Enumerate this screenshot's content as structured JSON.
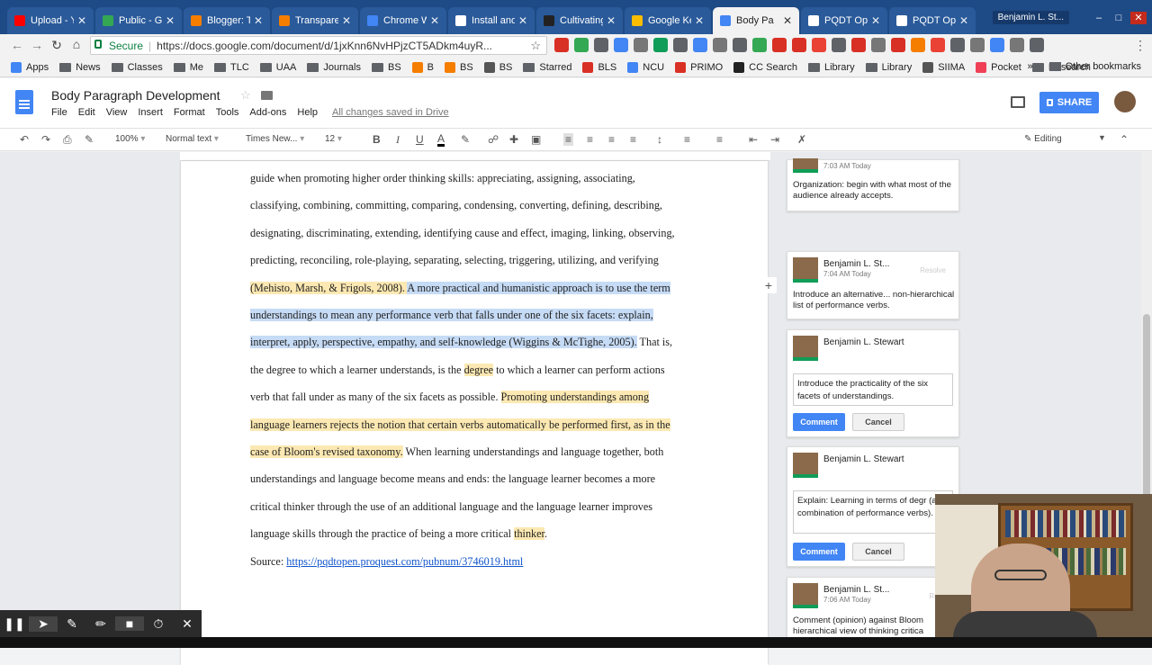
{
  "browser": {
    "tabs": [
      {
        "label": "Upload - Yo",
        "color": "#ff0000"
      },
      {
        "label": "Public - Go",
        "color": "#34a853"
      },
      {
        "label": "Blogger: Tr",
        "color": "#f57d00"
      },
      {
        "label": "Transparen",
        "color": "#f57d00"
      },
      {
        "label": "Chrome W",
        "color": "#4285f4"
      },
      {
        "label": "Install and",
        "color": "#ffffff"
      },
      {
        "label": "Cultivating",
        "color": "#222222"
      },
      {
        "label": "Google Ke",
        "color": "#fbbc04"
      },
      {
        "label": "Body Pa",
        "color": "#4285f4",
        "active": true
      },
      {
        "label": "PQDT Ope",
        "color": "#ffffff"
      },
      {
        "label": "PQDT Ope",
        "color": "#ffffff"
      }
    ],
    "window_user": "Benjamin L. St...",
    "address": {
      "secure_label": "Secure",
      "url": "https://docs.google.com/document/d/1jxKnn6NvHPjzCT5ADkm4uyR..."
    },
    "bookmarks": [
      {
        "label": "Apps",
        "type": "apps"
      },
      {
        "label": "News",
        "type": "folder"
      },
      {
        "label": "Classes",
        "type": "folder"
      },
      {
        "label": "Me",
        "type": "folder"
      },
      {
        "label": "TLC",
        "type": "folder"
      },
      {
        "label": "UAA",
        "type": "folder"
      },
      {
        "label": "Journals",
        "type": "folder"
      },
      {
        "label": "BS",
        "type": "folder"
      },
      {
        "label": "B",
        "type": "blogger"
      },
      {
        "label": "BS",
        "type": "blogger"
      },
      {
        "label": "BS",
        "type": "doc"
      },
      {
        "label": "Starred",
        "type": "folder"
      },
      {
        "label": "BLS",
        "type": "red"
      },
      {
        "label": "NCU",
        "type": "cloud"
      },
      {
        "label": "PRIMO",
        "type": "primo"
      },
      {
        "label": "CC Search",
        "type": "cc"
      },
      {
        "label": "Library",
        "type": "folder"
      },
      {
        "label": "Library",
        "type": "folder"
      },
      {
        "label": "SIIMA",
        "type": "doc"
      },
      {
        "label": "Pocket",
        "type": "pocket"
      },
      {
        "label": "Research",
        "type": "folder"
      }
    ],
    "other_bookmarks": "Other bookmarks"
  },
  "docs": {
    "title": "Body Paragraph Development",
    "menu": [
      "File",
      "Edit",
      "View",
      "Insert",
      "Format",
      "Tools",
      "Add-ons",
      "Help"
    ],
    "saved_status": "All changes saved in Drive",
    "share_label": "SHARE",
    "toolbar": {
      "zoom": "100%",
      "style": "Normal text",
      "font": "Times New...",
      "size": "12",
      "mode": "Editing"
    }
  },
  "document": {
    "lines": [
      [
        {
          "t": "guide when promoting higher order thinking skills: appreciating, assigning, associating,"
        }
      ],
      [
        {
          "t": "classifying, combining, committing, comparing, condensing, converting, defining, describing,"
        }
      ],
      [
        {
          "t": "designating, discriminating, extending, identifying cause and effect, imaging, linking, observing,"
        }
      ],
      [
        {
          "t": "predicting, reconciling, role-playing, separating, selecting, triggering, utilizing, and verifying"
        }
      ],
      [
        {
          "t": "(Mehisto, Marsh, & Frigols, 2008). ",
          "c": "hl"
        },
        {
          "t": "A more practical and humanistic approach is to use the term",
          "c": "sel"
        }
      ],
      [
        {
          "t": "understandings to mean any performance verb that falls under one of the six facets: explain,",
          "c": "sel"
        }
      ],
      [
        {
          "t": "interpret, apply, perspective, empathy, and self-knowledge (Wiggins & McTighe, 2005).",
          "c": "sel"
        },
        {
          "t": " That is,"
        }
      ],
      [
        {
          "t": "the degree to which a learner understands, is the "
        },
        {
          "t": "degree",
          "c": "hl"
        },
        {
          "t": " to which a learner can perform actions"
        }
      ],
      [
        {
          "t": "verb that fall under as many of the six facets as possible. "
        },
        {
          "t": "Promoting understandings among",
          "c": "hl"
        }
      ],
      [
        {
          "t": "language learners rejects the notion that certain verbs automatically be performed first, as in the",
          "c": "hl"
        }
      ],
      [
        {
          "t": "case of Bloom's revised taxonomy.",
          "c": "hl"
        },
        {
          "t": " When learning understandings and language together, both"
        }
      ],
      [
        {
          "t": "understandings and language become means and ends: the language learner becomes a more"
        }
      ],
      [
        {
          "t": "critical thinker through the use of an additional language and the language learner improves"
        }
      ],
      [
        {
          "t": "language skills through the practice of being a more critical "
        },
        {
          "t": "thinker",
          "c": "hl"
        },
        {
          "t": "."
        }
      ]
    ],
    "source_label": "Source: ",
    "source_link": "https://pqdtopen.proquest.com/pubnum/3746019.html"
  },
  "comments": [
    {
      "time": "7:03 AM Today",
      "body": "Organization: begin with what most of the audience already accepts."
    },
    {
      "name": "Benjamin L. St...",
      "time": "7:04 AM Today",
      "resolve": "Resolve",
      "body": "Introduce an alternative... non-hierarchical list of performance verbs."
    },
    {
      "name": "Benjamin L. Stewart",
      "input": "Introduce the practicality of the six facets of understandings.",
      "comment_btn": "Comment",
      "cancel_btn": "Cancel"
    },
    {
      "name": "Benjamin L. Stewart",
      "input": "Explain: Learning in terms of degr (a combination of performance verbs).",
      "comment_btn": "Comment",
      "cancel_btn": "Cancel"
    },
    {
      "name": "Benjamin L. St...",
      "time": "7:06 AM Today",
      "resolve": "Reso",
      "body": "Comment (opinion) against Bloom hierarchical view of thinking critica"
    }
  ]
}
